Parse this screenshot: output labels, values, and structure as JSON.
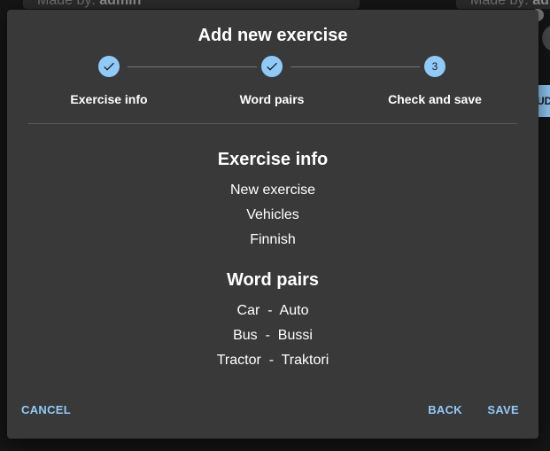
{
  "background": {
    "left_card_label": "Made by:",
    "left_card_user": "admin",
    "right_card_label": "Made by:",
    "right_card_user": "adr",
    "right_button_text": "UD"
  },
  "dialog": {
    "title": "Add new exercise",
    "steps": [
      {
        "label": "Exercise info",
        "state": "completed"
      },
      {
        "label": "Word pairs",
        "state": "completed"
      },
      {
        "label": "Check and save",
        "state": "active",
        "number": "3"
      }
    ],
    "exercise_info": {
      "heading": "Exercise info",
      "name": "New exercise",
      "topic": "Vehicles",
      "language": "Finnish"
    },
    "word_pairs": {
      "heading": "Word pairs",
      "separator": "-",
      "pairs": [
        {
          "word": "Car",
          "translation": "Auto"
        },
        {
          "word": "Bus",
          "translation": "Bussi"
        },
        {
          "word": "Tractor",
          "translation": "Traktori"
        }
      ]
    },
    "actions": {
      "cancel_label": "CANCEL",
      "back_label": "BACK",
      "save_label": "SAVE"
    }
  },
  "colors": {
    "accent": "#90caf9",
    "dialog_bg": "#393939",
    "page_bg": "#151515"
  },
  "icons": {
    "completed_step": "check-icon"
  }
}
